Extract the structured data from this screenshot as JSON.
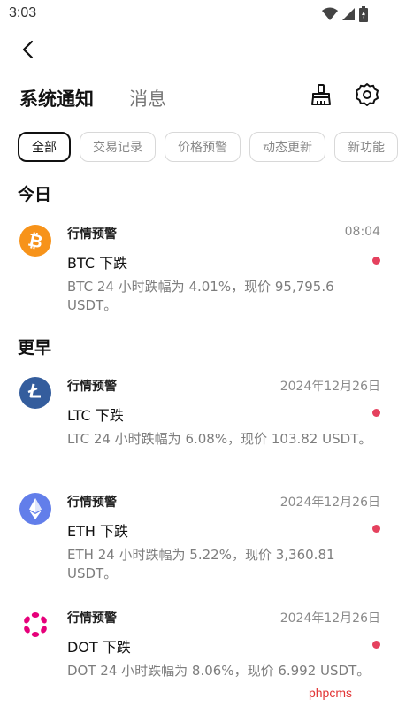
{
  "status_bar": {
    "time": "3:03"
  },
  "header": {
    "tabs": [
      {
        "label": "系统通知",
        "active": true
      },
      {
        "label": "消息",
        "active": false
      }
    ],
    "actions": [
      "broom-icon",
      "gear-icon"
    ]
  },
  "filters": [
    {
      "label": "全部",
      "active": true
    },
    {
      "label": "交易记录",
      "active": false
    },
    {
      "label": "价格预警",
      "active": false
    },
    {
      "label": "动态更新",
      "active": false
    },
    {
      "label": "新功能",
      "active": false
    }
  ],
  "sections": {
    "today": {
      "title": "今日"
    },
    "earlier": {
      "title": "更早"
    }
  },
  "notifications": [
    {
      "coin": "BTC",
      "icon": "bitcoin-icon",
      "color": "#F7931A",
      "category": "行情预警",
      "time": "08:04",
      "title": "BTC 下跌",
      "body": "BTC 24 小时跌幅为 4.01%，现价 95,795.6 USDT。",
      "unread": true
    },
    {
      "coin": "LTC",
      "icon": "litecoin-icon",
      "color": "#345D9D",
      "category": "行情预警",
      "time": "2024年12月26日",
      "title": "LTC 下跌",
      "body": "LTC 24 小时跌幅为 6.08%，现价 103.82 USDT。",
      "unread": true
    },
    {
      "coin": "ETH",
      "icon": "ethereum-icon",
      "color": "#627EEA",
      "category": "行情预警",
      "time": "2024年12月26日",
      "title": "ETH 下跌",
      "body": "ETH 24 小时跌幅为 5.22%，现价 3,360.81 USDT。",
      "unread": true
    },
    {
      "coin": "DOT",
      "icon": "polkadot-icon",
      "color": "#E6007A",
      "category": "行情预警",
      "time": "2024年12月26日",
      "title": "DOT 下跌",
      "body": "DOT 24 小时跌幅为 8.06%，现价 6.992 USDT。",
      "unread": true
    }
  ],
  "watermark": "phpcms",
  "colors": {
    "unread_dot": "#E5415E",
    "text_muted": "#7D7D7D"
  }
}
